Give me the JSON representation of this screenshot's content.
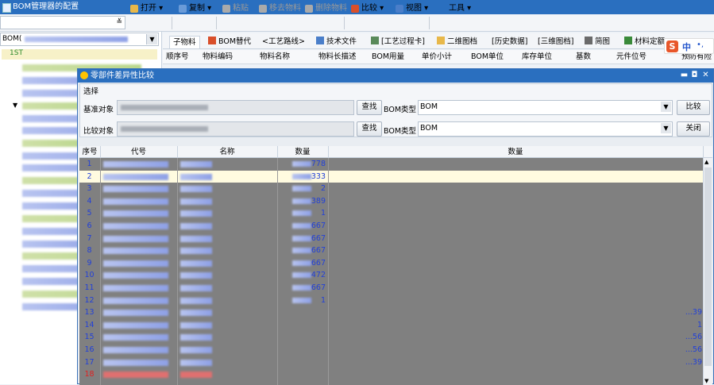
{
  "app": {
    "title": "BOM管理器的配置"
  },
  "toolbar": {
    "items": [
      {
        "label": "打开 ▾",
        "icon": "folder-open-icon",
        "enabled": true
      },
      {
        "label": "复制 ▾",
        "icon": "copy-icon",
        "enabled": true
      },
      {
        "label": "粘贴",
        "icon": "paste-icon",
        "enabled": false
      },
      {
        "label": "移去物料",
        "icon": "remove-material-icon",
        "enabled": false
      },
      {
        "label": "删除物料",
        "icon": "delete-material-icon",
        "enabled": false
      },
      {
        "label": "比较 ▾",
        "icon": "compare-icon",
        "enabled": true
      },
      {
        "label": "视图 ▾",
        "icon": "view-icon",
        "enabled": true
      },
      {
        "label": "工具 ▾",
        "icon": "tools-icon",
        "enabled": true
      }
    ]
  },
  "left_panel": {
    "combo_prefix": "BOM(",
    "tree_prefix": "1ST"
  },
  "tabs": [
    {
      "label": "子物料",
      "active": true,
      "icon": ""
    },
    {
      "label": "BOM替代",
      "active": false,
      "icon": "bom-replace-icon"
    },
    {
      "label": "<工艺路线>",
      "active": false,
      "icon": ""
    },
    {
      "label": "技术文件",
      "active": false,
      "icon": "tech-file-icon"
    },
    {
      "label": "[工艺过程卡]",
      "active": false,
      "icon": "process-card-icon"
    },
    {
      "label": "二维图档",
      "active": false,
      "icon": "2d-drawing-icon"
    },
    {
      "label": "[历史数据]",
      "active": false,
      "icon": ""
    },
    {
      "label": "[三维图档]",
      "active": false,
      "icon": ""
    },
    {
      "label": "简图",
      "active": false,
      "icon": "sketch-icon"
    },
    {
      "label": "材料定额",
      "active": false,
      "icon": "material-quota-icon"
    }
  ],
  "main_columns": [
    "顺序号",
    "物料编码",
    "物料名称",
    "物料长描述",
    "BOM用量",
    "单价小计",
    "BOM单位",
    "库存单位",
    "基数",
    "元件位号",
    "预防有险"
  ],
  "ime": {
    "s": "S",
    "mode": "中"
  },
  "dialog": {
    "title": "零部件差异性比较",
    "group_label": "选择",
    "base_label": "基准对象",
    "compare_label": "比较对象",
    "find_label": "查找",
    "bom_type_label": "BOM类型",
    "bom_type_value": "BOM",
    "compare_button": "比较",
    "close_button": "关闭",
    "grid_columns": [
      "序号",
      "代号",
      "名称",
      "数量",
      "数量"
    ],
    "rows": [
      {
        "seq": "1",
        "qty": "778",
        "right": ""
      },
      {
        "seq": "2",
        "qty": "333",
        "right": ""
      },
      {
        "seq": "3",
        "qty": "2",
        "right": ""
      },
      {
        "seq": "4",
        "qty": "389",
        "right": ""
      },
      {
        "seq": "5",
        "qty": "1",
        "right": ""
      },
      {
        "seq": "6",
        "qty": "667",
        "right": ""
      },
      {
        "seq": "7",
        "qty": "667",
        "right": ""
      },
      {
        "seq": "8",
        "qty": "667",
        "right": ""
      },
      {
        "seq": "9",
        "qty": "667",
        "right": ""
      },
      {
        "seq": "10",
        "qty": "472",
        "right": ""
      },
      {
        "seq": "11",
        "qty": "667",
        "right": ""
      },
      {
        "seq": "12",
        "qty": "1",
        "right": ""
      },
      {
        "seq": "13",
        "qty": "",
        "right": "...39"
      },
      {
        "seq": "14",
        "qty": "",
        "right": "1"
      },
      {
        "seq": "15",
        "qty": "",
        "right": "...56"
      },
      {
        "seq": "16",
        "qty": "",
        "right": "...56"
      },
      {
        "seq": "17",
        "qty": "",
        "right": "...39"
      },
      {
        "seq": "18",
        "qty": "",
        "right": ""
      }
    ]
  }
}
